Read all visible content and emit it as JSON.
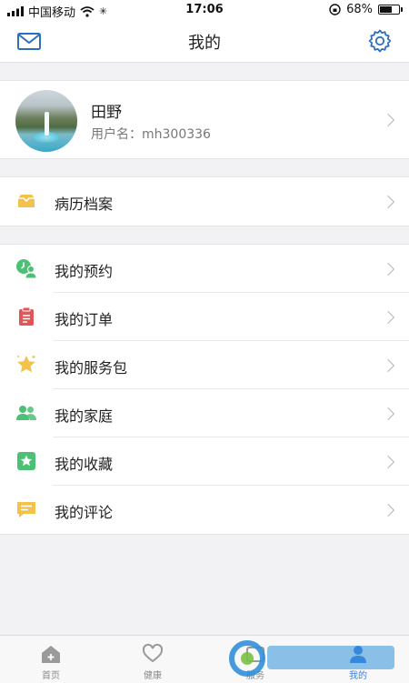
{
  "status_bar": {
    "carrier": "中国移动",
    "time": "17:06",
    "battery_pct": "68%",
    "battery_level": 0.68
  },
  "nav": {
    "title": "我的"
  },
  "profile": {
    "name": "田野",
    "username": "用户名：mh300336"
  },
  "groups": [
    {
      "items": [
        {
          "label": "病历档案",
          "icon": "folder-icon",
          "color": "#f2c24a"
        }
      ]
    },
    {
      "items": [
        {
          "label": "我的预约",
          "icon": "appointment-icon",
          "color": "#4cc074"
        },
        {
          "label": "我的订单",
          "icon": "order-icon",
          "color": "#e05656"
        },
        {
          "label": "我的服务包",
          "icon": "star-icon",
          "color": "#f2c24a"
        },
        {
          "label": "我的家庭",
          "icon": "family-icon",
          "color": "#4cc074"
        },
        {
          "label": "我的收藏",
          "icon": "favorite-icon",
          "color": "#4cc074"
        },
        {
          "label": "我的评论",
          "icon": "comment-icon",
          "color": "#f2c24a"
        }
      ]
    }
  ],
  "tabs": [
    {
      "label": "首页",
      "icon": "home-icon"
    },
    {
      "label": "健康",
      "icon": "heart-icon"
    },
    {
      "label": "服务",
      "icon": "service-icon"
    },
    {
      "label": "我的",
      "icon": "user-icon"
    }
  ],
  "colors": {
    "accent": "#2d6fbd",
    "background": "#f2f2f4",
    "active_tab": "#3f7fe0"
  }
}
